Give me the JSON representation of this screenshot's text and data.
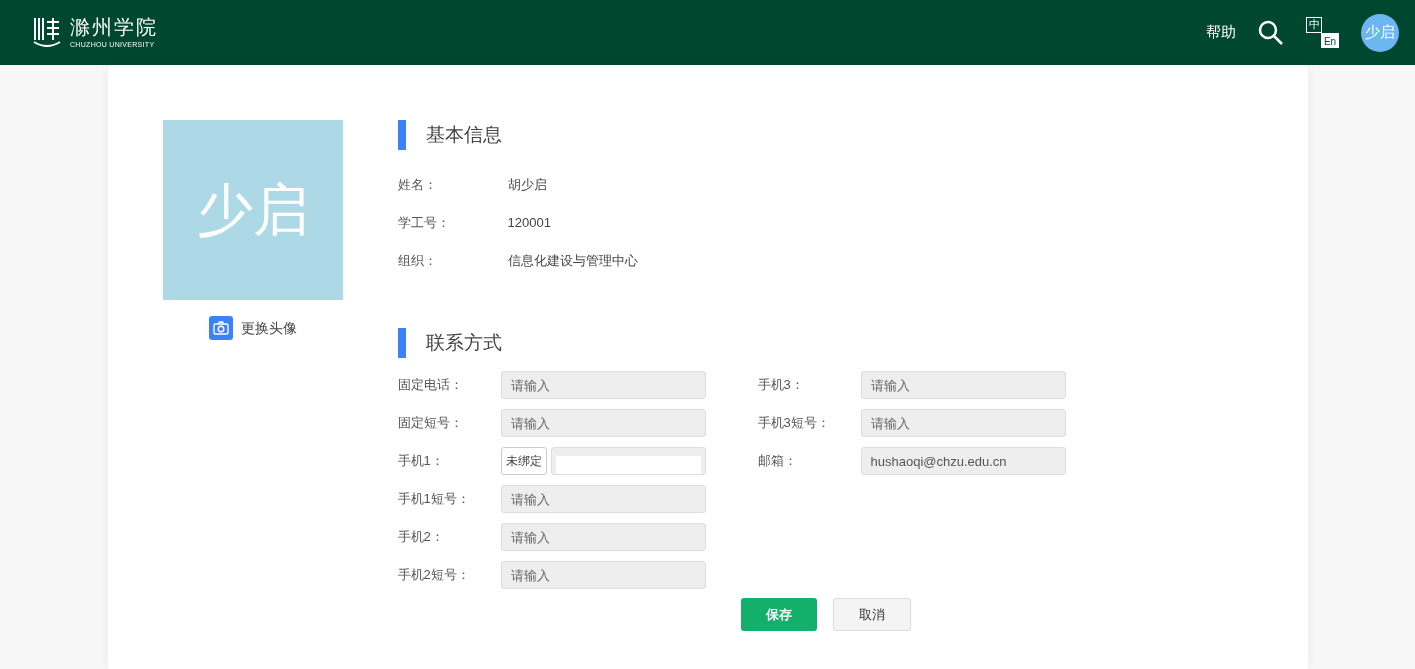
{
  "header": {
    "logo_name": "滁州学院",
    "logo_subtitle": "CHUZHOU UNIVERSITY",
    "help": "帮助",
    "language_options": [
      {
        "label": "中",
        "selected": true
      },
      {
        "label": "En",
        "selected": false
      }
    ],
    "user_avatar": "少启"
  },
  "profile": {
    "avatar_text": "少启",
    "change_avatar": "更换头像"
  },
  "basic_info": {
    "title": "基本信息",
    "items": [
      {
        "label": "姓名：",
        "value": "胡少启"
      },
      {
        "label": "学工号：",
        "value": "120001"
      },
      {
        "label": "组织：",
        "value": "信息化建设与管理中心"
      }
    ]
  },
  "contact": {
    "title": "联系方式",
    "columns": [
      [
        {
          "kind": "text",
          "label": "固定电话：",
          "placeholder": "请输入"
        },
        {
          "kind": "text",
          "label": "固定短号：",
          "placeholder": "请输入"
        },
        {
          "kind": "bind",
          "label": "手机1：",
          "button": "未绑定"
        },
        {
          "kind": "text",
          "label": "手机1短号：",
          "placeholder": "请输入"
        },
        {
          "kind": "text",
          "label": "手机2：",
          "placeholder": "请输入"
        },
        {
          "kind": "text",
          "label": "手机2短号：",
          "placeholder": "请输入"
        }
      ],
      [
        {
          "kind": "text",
          "label": "手机3：",
          "placeholder": "请输入"
        },
        {
          "kind": "text",
          "label": "手机3短号：",
          "placeholder": "请输入"
        },
        {
          "kind": "text",
          "label": "邮箱：",
          "value": "hushaoqi@chzu.edu.cn"
        }
      ]
    ]
  },
  "buttons": {
    "save": "保存",
    "cancel": "取消"
  }
}
